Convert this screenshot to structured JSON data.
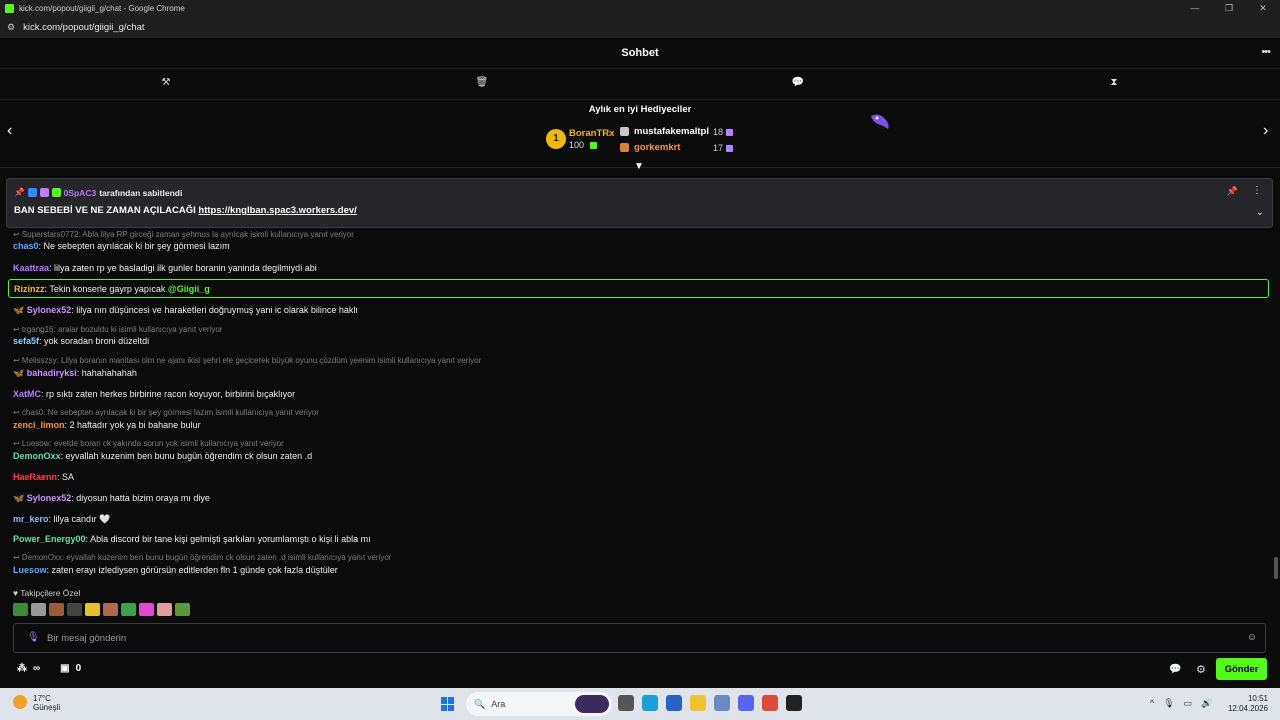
{
  "window": {
    "title": "kick.com/popout/giigii_g/chat - Google Chrome",
    "url": "kick.com/popout/giigii_g/chat"
  },
  "chat": {
    "title": "Sohbet"
  },
  "gifters": {
    "heading": "Aylık en iyi Hediyeciler",
    "rank1": {
      "rank": "1",
      "name": "BoranTRx",
      "count": "100"
    },
    "rank2": {
      "name": "mustafakemaltpl",
      "count": "18"
    },
    "rank3": {
      "name": "gorkemkrt",
      "count": "17"
    }
  },
  "pinned": {
    "pinned_by": "0SpAC3",
    "pinned_suffix": "tarafından sabitlendi",
    "text": "BAN SEBEBİ VE NE ZAMAN AÇILACAĞI",
    "link": "https://knglban.spac3.workers.dev/"
  },
  "messages": [
    {
      "reply": "Superstars0772: Abla lilya RP girceği zaman şehmus la ayrılcak isimli kullanıcıya yanıt veriyor",
      "user": "chas0",
      "color": "#5da9ff",
      "text": "Ne sebepten ayrılacak ki bir şey görmesi lazım"
    },
    {
      "user": "Kaattraa",
      "color": "#b57bff",
      "text": "lilya zaten rp ye basladigi ilk gunler boranin yaninda degilmiydi abi"
    },
    {
      "user": "Rizinzz",
      "color": "#f0b830",
      "text": "Tekin konserle gayrp yapıcak",
      "mention": "@Giigii_g"
    },
    {
      "user": "Sylonex52",
      "color": "#c894ff",
      "text": "lilya nın düşüncesi ve haraketleri doğruymuş yani ic olarak bilince haklı"
    },
    {
      "reply": "trgang16: aralar bozuldu ki isimli kullanıcıya yanıt veriyor",
      "user": "sefa5f",
      "color": "#8fd0ff",
      "text": "yok soradan broni düzeltdi"
    },
    {
      "reply": "Melisszsy: Lilya boranın manitası olm ne ajanı ikisi şehri ele geçicerek büyük oyunu çözdüm yeenim isimli kullanıcıya yanıt veriyor",
      "user": "bahadiryksi",
      "color": "#c894ff",
      "text": "hahahahahah"
    },
    {
      "user": "XatMC",
      "color": "#b57bff",
      "text": "rp sıktı zaten herkes birbirine racon koyuyor, birbirini bıçaklıyor"
    },
    {
      "reply": "chas0: Ne sebepten ayrılacak ki bir şey görmesi lazım isimli kullanıcıya yanıt veriyor",
      "user": "zenci_limon",
      "color": "#f39a2e",
      "text": "2 haftadır yok ya bi bahane bulur"
    },
    {
      "reply": "Luesow: evetde boran ck yakında sorun yok isimli kullanıcıya yanıt veriyor",
      "user": "DemonOxx",
      "color": "#5fe0b0",
      "text": "eyvallah kuzenim ben bunu bugün öğrendim ck olsun zaten .d"
    },
    {
      "user": "HaeRaenn",
      "color": "#ff3b5c",
      "text": "SA"
    },
    {
      "user": "Sylonex52",
      "color": "#c894ff",
      "text": "diyosun hatta bizim oraya mı diye"
    },
    {
      "user": "mr_kero",
      "color": "#8fb8ff",
      "text": "lilya candır 🤍"
    },
    {
      "user": "Power_Energy00",
      "color": "#5fe0b0",
      "text": "Abla discord bir tane kişi gelmişti şarkıları yorumlamıştı o kişi li abla mı"
    },
    {
      "reply": "DemonOxx: eyvallah kuzenim ben bunu bugün öğrendim ck olsun zaten .d isimli kullanıcıya yanıt veriyor",
      "user": "Luesow",
      "color": "#5da9ff",
      "text": "zaten erayı izlediysen görürsün editlerden fln 1 günde çok fazla düştüler"
    }
  ],
  "followers_only": "Takipçilere Özel",
  "input": {
    "placeholder": "Bir mesaj gönderin"
  },
  "bottom": {
    "infinity": "∞",
    "count": "0",
    "send": "Gönder"
  },
  "taskbar": {
    "temp": "17°C",
    "weather": "Güneşli",
    "search": "Ara",
    "time": "10:51",
    "date": "12.04.2026"
  }
}
